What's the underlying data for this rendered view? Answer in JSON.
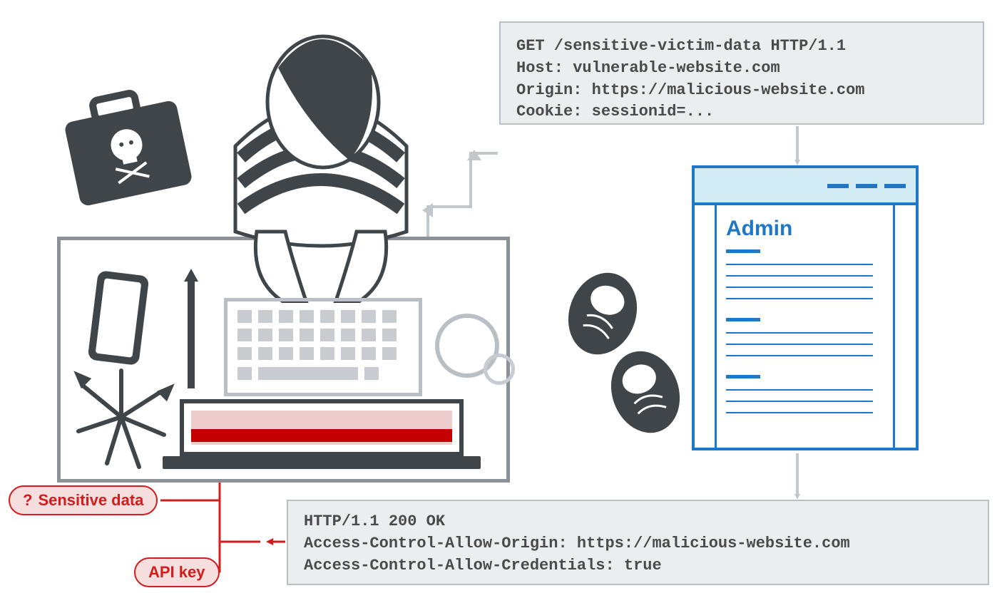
{
  "request": {
    "line1": "GET /sensitive-victim-data HTTP/1.1",
    "line2": "Host: vulnerable-website.com",
    "line3": "Origin: https://malicious-website.com",
    "line4": "Cookie: sessionid=..."
  },
  "browser": {
    "title": "Admin"
  },
  "response": {
    "line1": "HTTP/1.1 200 OK",
    "line2": "Access-Control-Allow-Origin: https://malicious-website.com",
    "line3": "Access-Control-Allow-Credentials: true"
  },
  "labels": {
    "sensitive_prefix": "?",
    "sensitive_text": "Sensitive data",
    "apikey": "API key"
  }
}
